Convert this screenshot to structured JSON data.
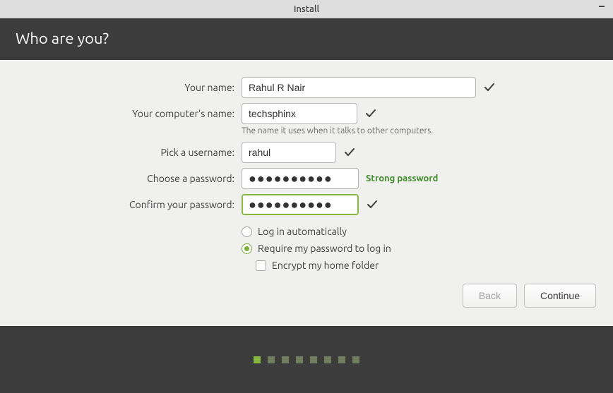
{
  "titlebar": {
    "title": "Install",
    "minimize": "–"
  },
  "header": {
    "title": "Who are you?"
  },
  "form": {
    "name_label": "Your name:",
    "name_value": "Rahul R Nair",
    "hostname_label": "Your computer's name:",
    "hostname_value": "techsphinx",
    "hostname_hint": "The name it uses when it talks to other computers.",
    "username_label": "Pick a username:",
    "username_value": "rahul",
    "password_label": "Choose a password:",
    "password_value": "●●●●●●●●●●",
    "password_strength": "Strong password",
    "confirm_label": "Confirm your password:",
    "confirm_value": "●●●●●●●●●●"
  },
  "options": {
    "auto_login": "Log in automatically",
    "require_password": "Require my password to log in",
    "encrypt_home": "Encrypt my home folder",
    "selected": "require_password"
  },
  "buttons": {
    "back": "Back",
    "continue": "Continue"
  },
  "progress": {
    "total": 8,
    "active": 0
  }
}
